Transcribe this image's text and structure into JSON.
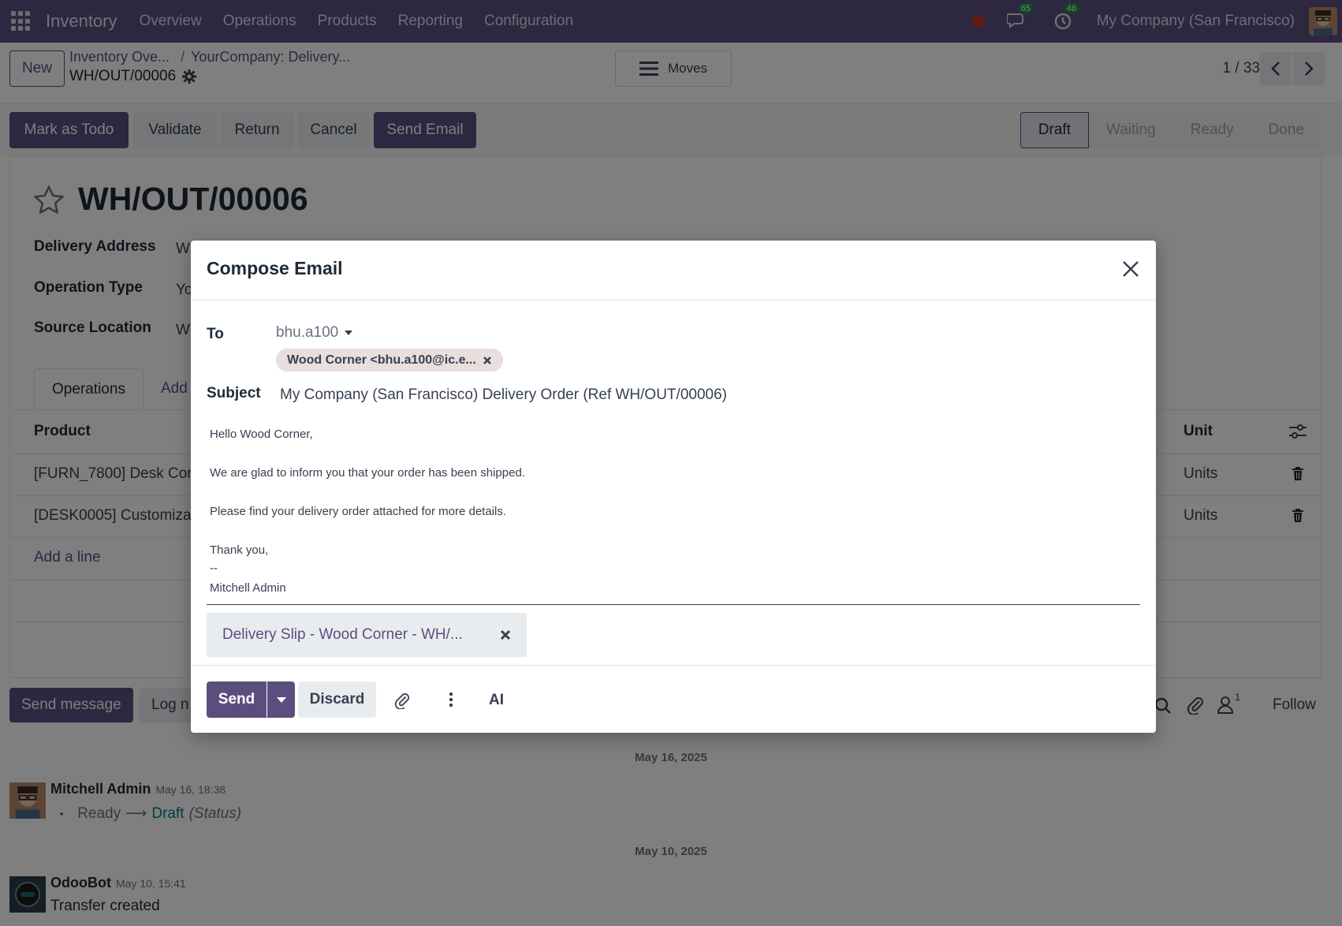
{
  "navbar": {
    "app_name": "Inventory",
    "menu": [
      "Overview",
      "Operations",
      "Products",
      "Reporting",
      "Configuration"
    ],
    "messages_count": "65",
    "activities_count": "46",
    "company": "My Company (San Francisco)"
  },
  "control": {
    "new_label": "New",
    "breadcrumb_1": "Inventory Ove...",
    "breadcrumb_sep": "/",
    "breadcrumb_2": "YourCompany: Delivery...",
    "record_name": "WH/OUT/00006",
    "moves_label": "Moves",
    "pager": "1 / 33"
  },
  "actions": {
    "mark_todo": "Mark as Todo",
    "validate": "Validate",
    "return": "Return",
    "cancel": "Cancel",
    "send_email": "Send Email"
  },
  "stages": [
    "Draft",
    "Waiting",
    "Ready",
    "Done"
  ],
  "form": {
    "title": "WH/OUT/00006",
    "delivery_address_label": "Delivery Address",
    "delivery_address_value": "W",
    "operation_type_label": "Operation Type",
    "operation_type_value": "Yo",
    "source_location_label": "Source Location",
    "source_location_value": "W",
    "tab_operations": "Operations",
    "tab_additional": "Add",
    "col_product": "Product",
    "col_unit": "Unit",
    "rows": [
      {
        "product": "[FURN_7800] Desk Cor",
        "unit": "Units"
      },
      {
        "product": "[DESK0005] Customiza",
        "unit": "Units"
      }
    ],
    "add_line": "Add a line"
  },
  "chatter": {
    "send_message": "Send message",
    "log_note": "Log n",
    "followers_count": "1",
    "follow": "Follow",
    "date_1": "May 16, 2025",
    "msg1_author": "Mitchell Admin",
    "msg1_time": "May 16, 18:38",
    "msg1_from": "Ready",
    "msg1_arrow": "⟶",
    "msg1_to": "Draft",
    "msg1_field": "(Status)",
    "date_2": "May 10, 2025",
    "msg2_author": "OdooBot",
    "msg2_time": "May 10, 15:41",
    "msg2_text": "Transfer created"
  },
  "modal": {
    "title": "Compose Email",
    "to_label": "To",
    "to_select": "bhu.a100",
    "recipient_tag": "Wood Corner <bhu.a100@ic.e...",
    "subject_label": "Subject",
    "subject_value": "My Company (San Francisco) Delivery Order (Ref WH/OUT/00006)",
    "body_lines": [
      "Hello Wood Corner,",
      "We are glad to inform you that your order has been shipped.",
      "Please find your delivery order attached for more details.",
      "Thank you,",
      "--",
      "Mitchell Admin"
    ],
    "attachment": "Delivery Slip - Wood Corner - WH/...",
    "send_label": "Send",
    "discard_label": "Discard",
    "ai_label": "AI"
  },
  "colors": {
    "brand": "#5b4e7e",
    "link": "#017e84"
  }
}
